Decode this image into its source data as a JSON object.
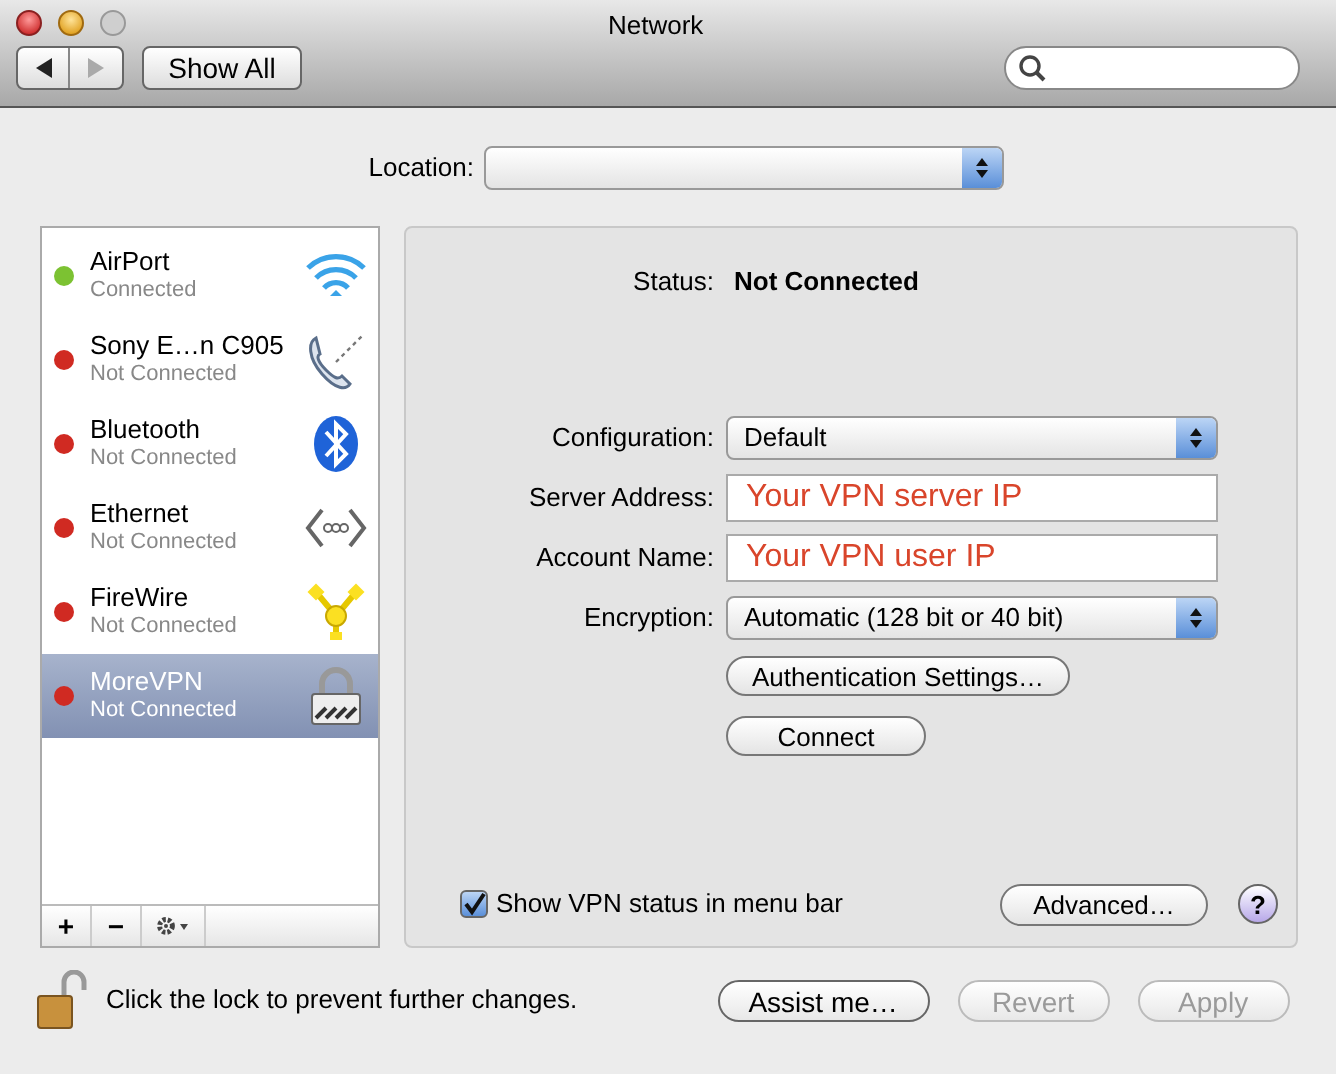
{
  "window": {
    "title": "Network"
  },
  "toolbar": {
    "show_all": "Show All"
  },
  "location": {
    "label": "Location:"
  },
  "services": [
    {
      "name": "AirPort",
      "status": "Connected",
      "color": "#7cc232",
      "kind": "wifi",
      "selected": false
    },
    {
      "name": "Sony E…n C905",
      "status": "Not Connected",
      "color": "#d02a22",
      "kind": "phone",
      "selected": false
    },
    {
      "name": "Bluetooth",
      "status": "Not Connected",
      "color": "#d02a22",
      "kind": "bluetooth",
      "selected": false
    },
    {
      "name": "Ethernet",
      "status": "Not Connected",
      "color": "#d02a22",
      "kind": "ethernet",
      "selected": false
    },
    {
      "name": "FireWire",
      "status": "Not Connected",
      "color": "#d02a22",
      "kind": "firewire",
      "selected": false
    },
    {
      "name": "MoreVPN",
      "status": "Not Connected",
      "color": "#d02a22",
      "kind": "vpn",
      "selected": true
    }
  ],
  "list_buttons": [
    "+",
    "−"
  ],
  "detail": {
    "status_label": "Status:",
    "status_value": "Not Connected",
    "fields": [
      {
        "kind": "popup",
        "label": "Configuration:",
        "value": "Default"
      },
      {
        "kind": "text",
        "label": "Server Address:",
        "value": "Your VPN server IP"
      },
      {
        "kind": "text",
        "label": "Account Name:",
        "value": "Your VPN user IP"
      },
      {
        "kind": "popup",
        "label": "Encryption:",
        "value": "Automatic (128 bit or 40 bit)"
      }
    ],
    "buttons": [
      "Authentication Settings…",
      "Connect"
    ],
    "show_status": {
      "label": "Show VPN status in menu bar",
      "checked": true
    },
    "advanced": "Advanced…",
    "help": "?"
  },
  "footer": {
    "lock_text": "Click the lock to prevent further changes.",
    "buttons": [
      {
        "label": "Assist me…",
        "disabled": false
      },
      {
        "label": "Revert",
        "disabled": true
      },
      {
        "label": "Apply",
        "disabled": true
      }
    ]
  }
}
